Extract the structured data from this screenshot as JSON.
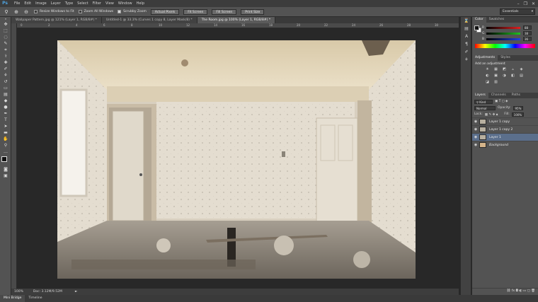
{
  "app": {
    "logo": "Ps"
  },
  "menu": [
    "File",
    "Edit",
    "Image",
    "Layer",
    "Type",
    "Select",
    "Filter",
    "View",
    "Window",
    "Help"
  ],
  "window_controls": {
    "minimize": "–",
    "restore": "❐",
    "close": "✕"
  },
  "options_bar": {
    "resize_windows": "Resize Windows to Fit",
    "zoom_all": "Zoom All Windows",
    "scrubby_zoom": "Scrubby Zoom",
    "actual_pixels": "Actual Pixels",
    "fit_screen": "Fit Screen",
    "fill_screen": "Fill Screen",
    "print_size": "Print Size",
    "workspace": "Essentials"
  },
  "tabs": [
    {
      "label": "Wallpaper Pattern.jpg @ 121% (Layer 1, RGB/8#) *"
    },
    {
      "label": "Untitled-1 @ 33.3% (Curves 1 copy 8, Layer Mask/8) *"
    },
    {
      "label": "The Room.jpg @ 100% (Layer 1, RGB/8#) *"
    }
  ],
  "ruler_ticks": [
    "0",
    "2",
    "4",
    "6",
    "8",
    "10",
    "12",
    "14",
    "16",
    "18",
    "20",
    "22",
    "24",
    "26",
    "28",
    "30"
  ],
  "status": {
    "zoom": "100%",
    "doc": "Doc: 3.12M/9.52M",
    "arrow": "►"
  },
  "bottom_tabs": [
    "Mini Bridge",
    "Timeline"
  ],
  "color_panel": {
    "tabs": [
      "Color",
      "Swatches"
    ],
    "channels": [
      {
        "label": "R",
        "value": "88",
        "color": "#c03030"
      },
      {
        "label": "G",
        "value": "38",
        "color": "#30a030"
      },
      {
        "label": "B",
        "value": "36",
        "color": "#3050c0"
      }
    ]
  },
  "adjustments_panel": {
    "tabs": [
      "Adjustments",
      "Styles"
    ],
    "title": "Add an adjustment",
    "icons": [
      "☀",
      "▦",
      "◩",
      "▵",
      "◈",
      "◐",
      "▣",
      "◑",
      "◧",
      "▤",
      "◪",
      "▥"
    ]
  },
  "layers_panel": {
    "tabs": [
      "Layers",
      "Channels",
      "Paths"
    ],
    "kind": "Kind",
    "blend_mode": "Normal",
    "opacity_label": "Opacity:",
    "opacity": "95%",
    "lock_label": "Lock:",
    "fill_label": "Fill:",
    "fill": "100%",
    "layers": [
      {
        "name": "Layer 1 copy",
        "selected": false
      },
      {
        "name": "Layer 1 copy 2",
        "selected": false
      },
      {
        "name": "Layer 1",
        "selected": true
      },
      {
        "name": "Background",
        "selected": false
      }
    ]
  }
}
